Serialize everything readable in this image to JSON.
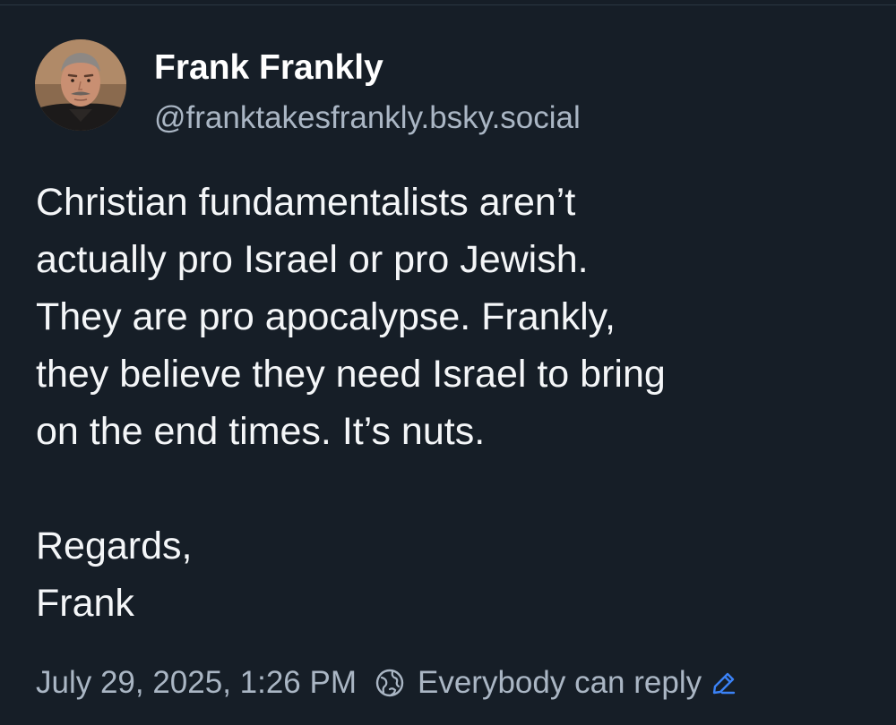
{
  "author": {
    "display_name": "Frank Frankly",
    "handle": "@franktakesfrankly.bsky.social"
  },
  "post": {
    "lines": [
      "Christian fundamentalists aren’t",
      "actually pro Israel or pro Jewish.",
      "They are pro apocalypse. Frankly,",
      "they believe they need Israel to bring",
      "on the end times. It’s nuts."
    ],
    "signoff_lines": [
      "Regards,",
      "Frank"
    ]
  },
  "meta": {
    "timestamp": "July 29, 2025, 1:26 PM",
    "reply_setting": "Everybody can reply",
    "reply_icon": "globe-icon",
    "edit_icon": "pencil-icon"
  },
  "colors": {
    "background": "#161e27",
    "text": "#f4f6f8",
    "muted": "#aab6c4",
    "accent": "#3b82f6"
  }
}
